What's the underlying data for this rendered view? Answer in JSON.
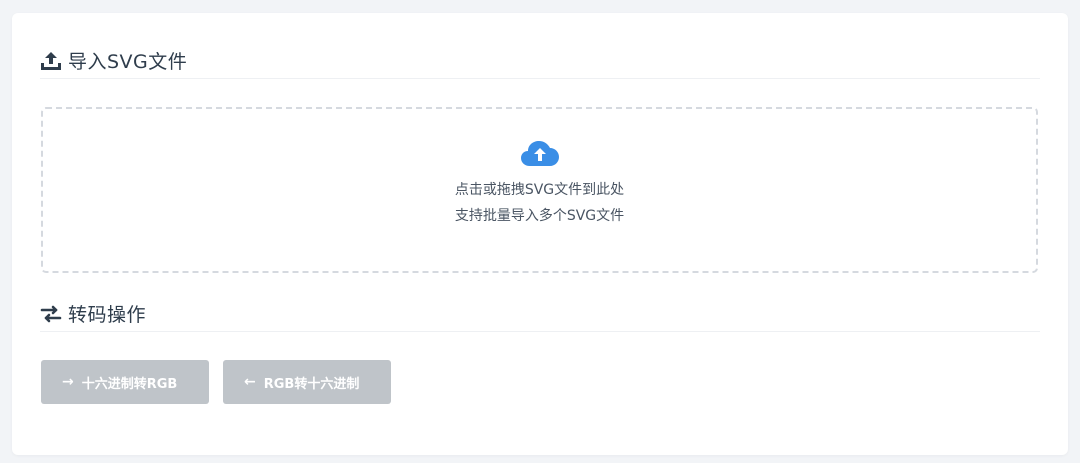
{
  "import_section": {
    "title": "导入SVG文件",
    "icon": "upload-icon"
  },
  "dropzone": {
    "icon": "cloud-upload-icon",
    "line1": "点击或拖拽SVG文件到此处",
    "line2": "支持批量导入多个SVG文件",
    "accent_color": "#3a8ee6"
  },
  "convert_section": {
    "title": "转码操作",
    "icon": "exchange-icon"
  },
  "buttons": {
    "hex_to_rgb": {
      "label": "十六进制转RGB",
      "arrow": "→",
      "icon": "arrow-right-icon",
      "disabled": true
    },
    "rgb_to_hex": {
      "label": "RGB转十六进制",
      "arrow": "←",
      "icon": "arrow-left-icon",
      "disabled": true
    }
  },
  "colors": {
    "page_bg": "#f2f4f7",
    "card_bg": "#ffffff",
    "heading": "#2f3d4c",
    "button_disabled": "#bfc4c9"
  }
}
